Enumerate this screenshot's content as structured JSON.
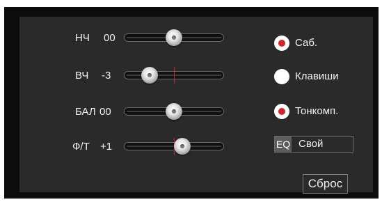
{
  "sliders": [
    {
      "label": "НЧ",
      "value": "00",
      "level": 0.5,
      "center_mark": false
    },
    {
      "label": "ВЧ",
      "value": "-3",
      "level": 0.2,
      "center_mark": true
    },
    {
      "label": "БАЛ",
      "value": "00",
      "level": 0.5,
      "center_mark": false
    },
    {
      "label": "Ф/Т",
      "value": "+1",
      "level": 0.6,
      "center_mark": true
    }
  ],
  "options": [
    {
      "label": "Саб.",
      "checked": true
    },
    {
      "label": "Клавиши",
      "checked": false
    },
    {
      "label": "Тонкомп.",
      "checked": true
    }
  ],
  "eq": {
    "tag": "EQ",
    "value": "Свой"
  },
  "reset": {
    "label": "Сброс"
  },
  "colors": {
    "accent": "#d0232a",
    "panel": "#2a2a2a",
    "frame": "#0c0c0c"
  }
}
